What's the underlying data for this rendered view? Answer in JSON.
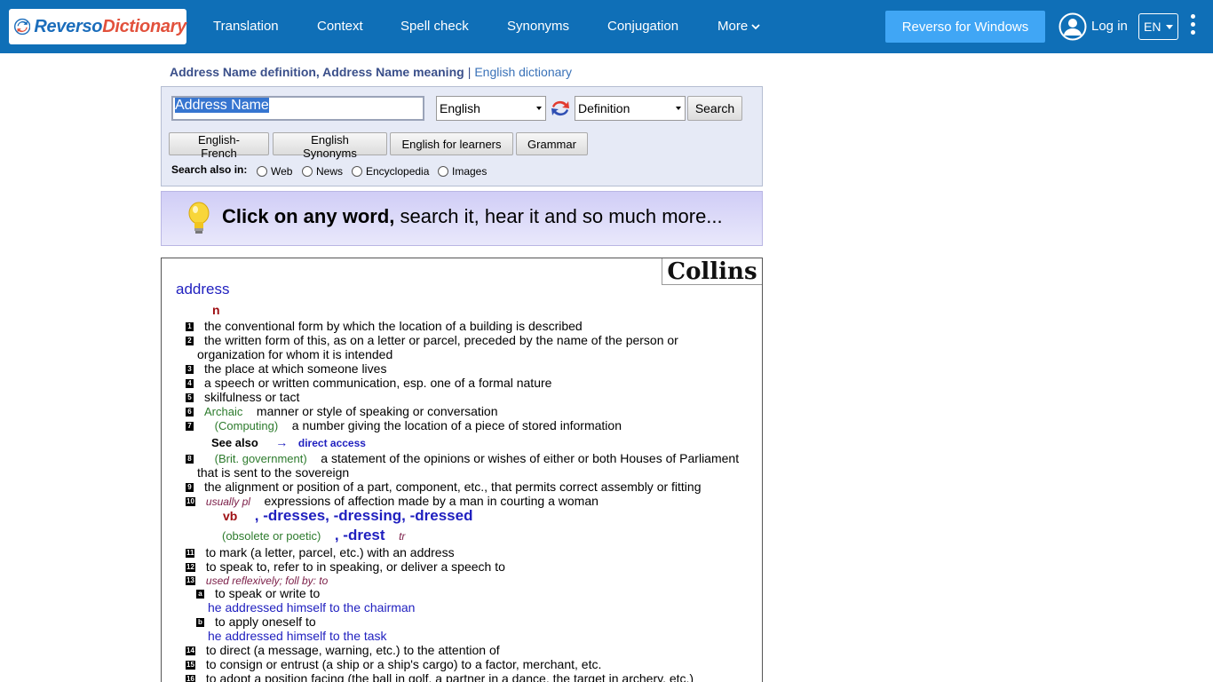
{
  "brand": {
    "part1": "Reverso",
    "part2": "Dictionary"
  },
  "nav": {
    "translation": "Translation",
    "context": "Context",
    "spell_check": "Spell check",
    "synonyms": "Synonyms",
    "conjugation": "Conjugation",
    "more": "More",
    "windows_button": "Reverso for Windows",
    "login": "Log in",
    "language": "EN"
  },
  "header": {
    "title": "Address Name definition, Address Name meaning",
    "separator": "|",
    "subtitle": "English dictionary"
  },
  "search": {
    "query": "Address Name",
    "language": "English",
    "mode": "Definition",
    "search_button": "Search",
    "buttons": [
      "English-French",
      "English Synonyms",
      "English for learners",
      "Grammar"
    ],
    "also_label": "Search also in:",
    "also_options": [
      "Web",
      "News",
      "Encyclopedia",
      "Images"
    ]
  },
  "promo": {
    "bold": "Click on any word,",
    "rest": " search it,  hear it  and so much more..."
  },
  "dictionary": {
    "source": "Collins",
    "headword": "address",
    "pos_noun": "n",
    "defs": [
      {
        "n": "1",
        "text": "the conventional form by which the location of a building is described"
      },
      {
        "n": "2",
        "text": "the written form of this, as on a letter or parcel, preceded by the name of the person or",
        "cont": "organization for whom it is intended"
      },
      {
        "n": "3",
        "text": "the place at which someone lives"
      },
      {
        "n": "4",
        "text": "a speech or written communication, esp. one of a formal nature"
      },
      {
        "n": "5",
        "text": "skilfulness or tact"
      },
      {
        "n": "6",
        "label": "Archaic",
        "text": "manner or style of speaking or conversation"
      },
      {
        "n": "7",
        "label": "(Computing)",
        "text": "a number giving the location of a piece of stored information"
      },
      {
        "n": "8",
        "label": "(Brit. government)",
        "text": "a statement of the opinions or wishes of either or both Houses of Parliament",
        "cont": "that is sent to the sovereign"
      },
      {
        "n": "9",
        "text": "the alignment or position of a part, component, etc., that permits correct assembly or fitting"
      },
      {
        "n": "10",
        "label": "usually pl",
        "text": "expressions of affection made by a man in courting a woman"
      }
    ],
    "see_also": "See also",
    "see_also_arrow": "→",
    "see_also_link": "direct access",
    "pos_verb": "vb",
    "verb_forms": ", -dresses, -dressing, -dressed",
    "obsolete_label": "(obsolete or poetic)",
    "obsolete_form": ", -drest",
    "transitive": "tr",
    "verb_defs": [
      {
        "n": "11",
        "text": "to mark (a letter, parcel, etc.) with an address"
      },
      {
        "n": "12",
        "text": "to speak to, refer to in speaking, or deliver a speech to"
      },
      {
        "n": "13",
        "label": "used reflexively; foll by: to"
      },
      {
        "n": "a",
        "text": "to speak or write to",
        "example": "he addressed himself to the chairman"
      },
      {
        "n": "b",
        "text": "to apply oneself to",
        "example": "he addressed himself to the task"
      },
      {
        "n": "14",
        "text": "to direct (a message, warning, etc.) to the attention of"
      },
      {
        "n": "15",
        "text": "to consign or entrust (a ship or a ship's cargo) to a factor, merchant, etc."
      },
      {
        "n": "16",
        "text": "to adopt a position facing (the ball in golf, a partner in a dance, the target in archery, etc.)"
      }
    ]
  }
}
